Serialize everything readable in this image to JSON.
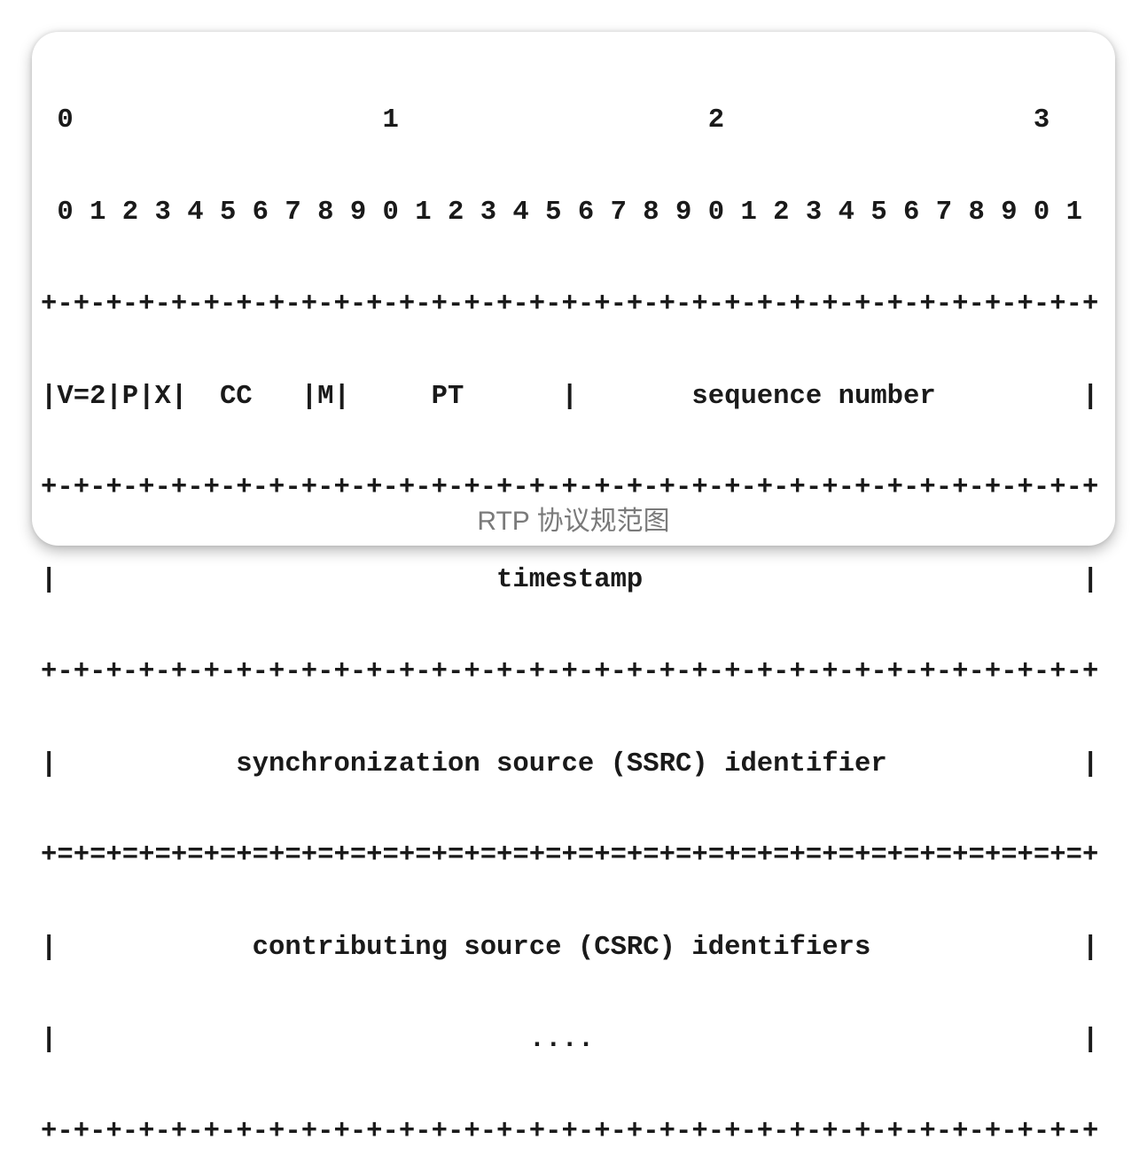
{
  "diagram": {
    "lines": [
      " 0                   1                   2                   3",
      " 0 1 2 3 4 5 6 7 8 9 0 1 2 3 4 5 6 7 8 9 0 1 2 3 4 5 6 7 8 9 0 1",
      "+-+-+-+-+-+-+-+-+-+-+-+-+-+-+-+-+-+-+-+-+-+-+-+-+-+-+-+-+-+-+-+-+",
      "|V=2|P|X|  CC   |M|     PT      |       sequence number         |",
      "+-+-+-+-+-+-+-+-+-+-+-+-+-+-+-+-+-+-+-+-+-+-+-+-+-+-+-+-+-+-+-+-+",
      "|                           timestamp                           |",
      "+-+-+-+-+-+-+-+-+-+-+-+-+-+-+-+-+-+-+-+-+-+-+-+-+-+-+-+-+-+-+-+-+",
      "|           synchronization source (SSRC) identifier            |",
      "+=+=+=+=+=+=+=+=+=+=+=+=+=+=+=+=+=+=+=+=+=+=+=+=+=+=+=+=+=+=+=+=+",
      "|            contributing source (CSRC) identifiers             |",
      "|                             ....                              |",
      "+-+-+-+-+-+-+-+-+-+-+-+-+-+-+-+-+-+-+-+-+-+-+-+-+-+-+-+-+-+-+-+-+"
    ],
    "caption": "RTP 协议规范图"
  }
}
